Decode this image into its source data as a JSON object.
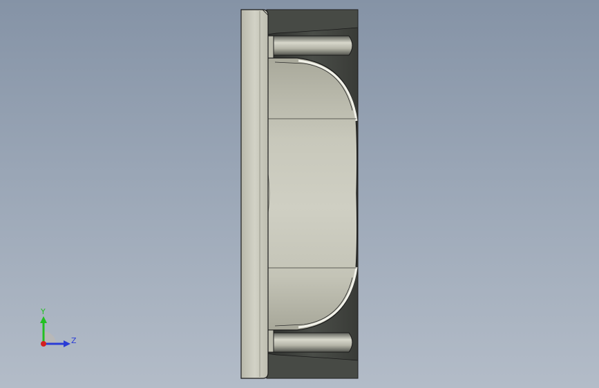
{
  "viewport": {
    "background_top": "#8593a6",
    "background_bottom": "#b3bcc8"
  },
  "part": {
    "face_color": "#c9c9bd",
    "dark_color": "#3f423f",
    "edge_color": "#1a1a1a"
  },
  "triad": {
    "y_label": "Y",
    "z_label": "Z",
    "y_color": "#22c022",
    "z_color": "#2a3cd6",
    "x_color": "#d42020"
  }
}
